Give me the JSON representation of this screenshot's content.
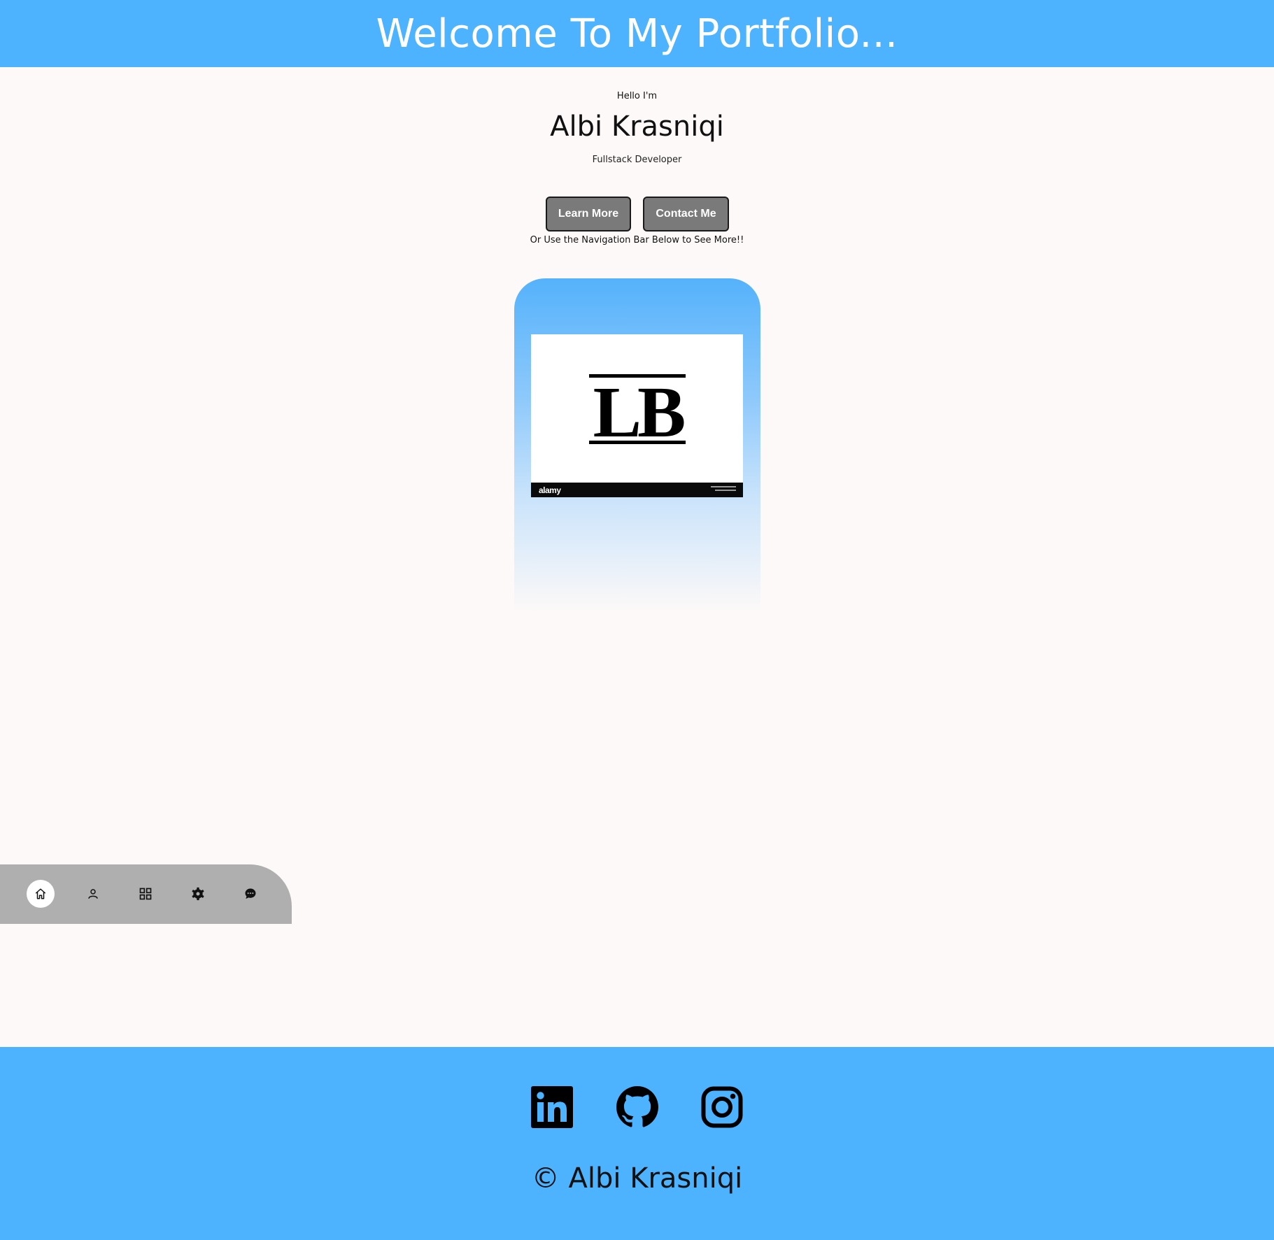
{
  "header": {
    "title": "Welcome To My Portfolio..."
  },
  "hero": {
    "greeting": "Hello I'm",
    "name": "Albi Krasniqi",
    "role": "Fullstack Developer",
    "buttons": {
      "learn_more": "Learn More",
      "contact_me": "Contact Me"
    },
    "nav_hint": "Or Use the Navigation Bar Below to See More!!"
  },
  "logo": {
    "letters": "LB",
    "stock_brand": "alamy"
  },
  "side_nav": {
    "items": [
      {
        "icon": "home-icon",
        "active": true
      },
      {
        "icon": "user-icon",
        "active": false
      },
      {
        "icon": "grid-icon",
        "active": false
      },
      {
        "icon": "gear-icon",
        "active": false
      },
      {
        "icon": "chat-icon",
        "active": false
      }
    ]
  },
  "footer": {
    "social": [
      "linkedin-icon",
      "github-icon",
      "instagram-icon"
    ],
    "copyright": "© Albi Krasniqi"
  },
  "colors": {
    "accent": "#4db3ff",
    "background": "#fdf9f8",
    "button": "#7a7a7a",
    "nav": "#b0afaf"
  }
}
